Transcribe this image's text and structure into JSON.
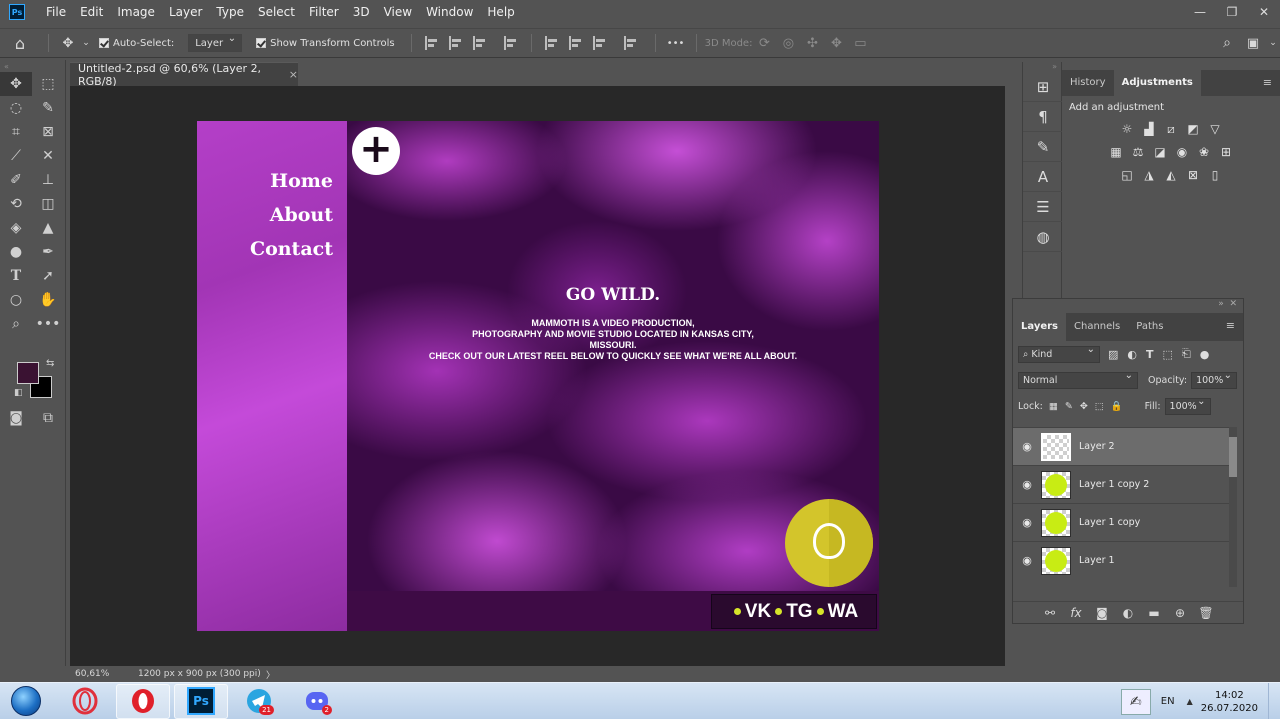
{
  "app": {
    "logo": "Ps"
  },
  "menu": [
    "File",
    "Edit",
    "Image",
    "Layer",
    "Type",
    "Select",
    "Filter",
    "3D",
    "View",
    "Window",
    "Help"
  ],
  "window_controls": {
    "minimize": "—",
    "restore": "❐",
    "close": "✕"
  },
  "options_bar": {
    "auto_select_label": "Auto-Select:",
    "auto_select_target": "Layer",
    "show_transform_label": "Show Transform Controls",
    "more": "•••",
    "mode_3d_label": "3D Mode:"
  },
  "document": {
    "tab_title": "Untitled-2.psd @ 60,6% (Layer 2, RGB/8)",
    "tab_close": "×",
    "zoom": "60,61%",
    "info": "1200 px x 900 px (300 ppi)",
    "info_arrow": "〉"
  },
  "artboard": {
    "nav": [
      "Home",
      "About",
      "Contact"
    ],
    "plus": "+",
    "hero_title": "GO WILD.",
    "hero_lines": [
      "MAMMOTH IS A VIDEO PRODUCTION,",
      "PHOTOGRAPHY AND MOVIE STUDIO LOCATED IN KANSAS CITY,",
      "MISSOURI.",
      "CHECK OUT OUR LATEST REEL BELOW TO QUICKLY SEE WHAT WE'RE ALL ABOUT."
    ],
    "social": [
      "VK",
      "TG",
      "WA"
    ],
    "colors": {
      "accent_lime": "#d6e52a",
      "sidebar_purple": "#b43fc8",
      "footer": "#3e0b45",
      "support_yellow": "#d3c52b"
    }
  },
  "adjustments_panel": {
    "tabs": [
      "History",
      "Adjustments"
    ],
    "active_tab": "Adjustments",
    "menu": "≡",
    "add_label": "Add an adjustment",
    "icons_row1": [
      "brightness-icon",
      "levels-icon",
      "curves-icon",
      "exposure-icon",
      "vibrance-icon"
    ],
    "icons_row2": [
      "hue-sat-icon",
      "color-balance-icon",
      "bw-icon",
      "photo-filter-icon",
      "channel-mixer-icon",
      "color-lookup-icon"
    ],
    "icons_row3": [
      "invert-icon",
      "posterize-icon",
      "threshold-icon",
      "selective-color-icon",
      "gradient-map-icon"
    ]
  },
  "layers_panel": {
    "tabs": [
      "Layers",
      "Channels",
      "Paths"
    ],
    "active_tab": "Layers",
    "menu": "≡",
    "kind": "Kind",
    "blend_mode": "Normal",
    "opacity_label": "Opacity:",
    "opacity_value": "100%",
    "lock_label": "Lock:",
    "fill_label": "Fill:",
    "fill_value": "100%",
    "layers": [
      {
        "name": "Layer 2",
        "thumb": "transparent",
        "selected": true
      },
      {
        "name": "Layer 1 copy 2",
        "thumb": "lime"
      },
      {
        "name": "Layer 1 copy",
        "thumb": "lime"
      },
      {
        "name": "Layer 1",
        "thumb": "lime"
      }
    ]
  },
  "taskbar": {
    "apps": [
      "opera-gx",
      "opera",
      "photoshop",
      "telegram",
      "discord"
    ],
    "photoshop_label": "Ps",
    "telegram_badge": "21",
    "discord_badge": "2",
    "lang": "EN",
    "tray_arrow": "▲",
    "time": "14:02",
    "date": "26.07.2020"
  }
}
